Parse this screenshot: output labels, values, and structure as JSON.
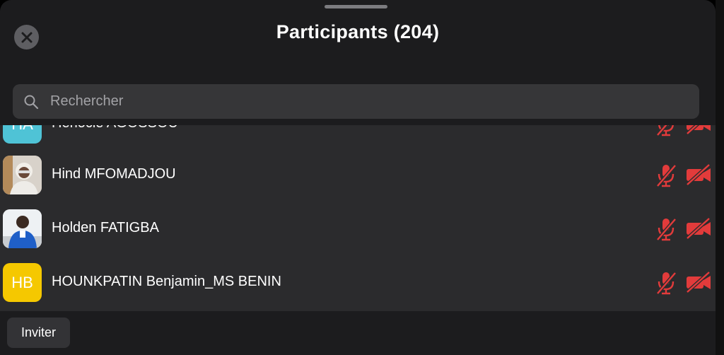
{
  "header": {
    "title": "Participants (204)"
  },
  "search": {
    "placeholder": "Rechercher"
  },
  "participants": [
    {
      "name": "Henocle AGOSSOU",
      "initials": "HA",
      "avatar_color": "#4fc3d6",
      "mic": "muted",
      "camera": "off"
    },
    {
      "name": "Hind MFOMADJOU",
      "initials": "",
      "avatar_type": "photo",
      "mic": "muted",
      "camera": "off"
    },
    {
      "name": "Holden FATIGBA",
      "initials": "",
      "avatar_type": "photo",
      "mic": "muted",
      "camera": "off"
    },
    {
      "name": "HOUNKPATIN Benjamin_MS BENIN",
      "initials": "HB",
      "avatar_color": "#f5c800",
      "mic": "muted",
      "camera": "off"
    }
  ],
  "footer": {
    "invite_label": "Inviter"
  },
  "colors": {
    "muted_red": "#e23b3b",
    "sheet_bg": "#1c1c1e",
    "list_bg": "#2b2b2d"
  }
}
